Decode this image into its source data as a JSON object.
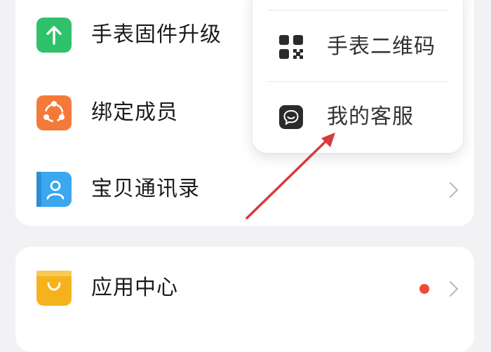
{
  "settings_list": {
    "firmware_upgrade": {
      "label": "手表固件升级",
      "icon": "upload-arrow-icon",
      "color": "#2fc26b"
    },
    "bind_members": {
      "label": "绑定成员",
      "icon": "members-icon",
      "color": "#f47a3a"
    },
    "contacts": {
      "label": "宝贝通讯录",
      "icon": "contact-book-icon",
      "color": "#3aa7ee"
    }
  },
  "app_section": {
    "app_center": {
      "label": "应用中心",
      "icon": "shopping-bag-icon",
      "color": "#f6b21d",
      "has_badge": true
    }
  },
  "popup_menu": {
    "items": [
      {
        "label": "手表二维码",
        "icon": "qr-code-icon"
      },
      {
        "label": "我的客服",
        "icon": "customer-service-icon"
      }
    ]
  },
  "annotation": {
    "color": "#d9393c"
  }
}
